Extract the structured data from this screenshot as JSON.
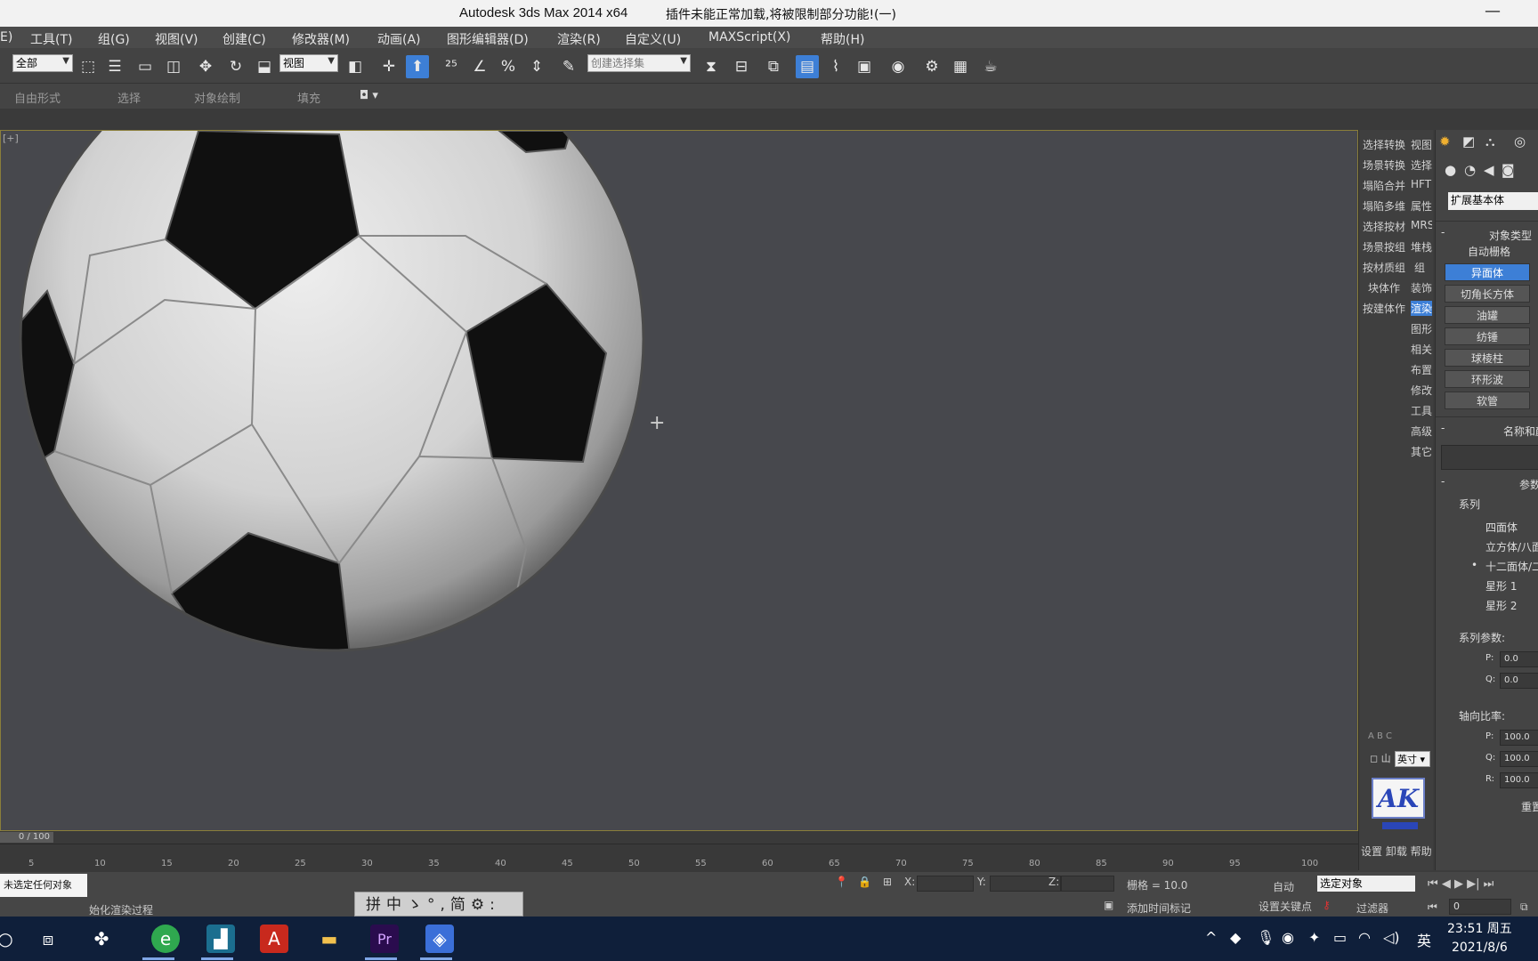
{
  "titlebar": {
    "title": "Autodesk 3ds Max  2014 x64",
    "warning": "插件未能正常加载,将被限制部分功能!(一)",
    "minimize": "—"
  },
  "menu": [
    "E)",
    "工具(T)",
    "组(G)",
    "视图(V)",
    "创建(C)",
    "修改器(M)",
    "动画(A)",
    "图形编辑器(D)",
    "渲染(R)",
    "自定义(U)",
    "MAXScript(X)",
    "帮助(H)"
  ],
  "toolbar": {
    "selection_filter": "全部",
    "ref_coord": "视图",
    "named_selection": "创建选择集"
  },
  "ribbon": [
    "自由形式",
    "选择",
    "对象绘制",
    "填充"
  ],
  "viewport": {
    "label": "[+]"
  },
  "cmdstrip": {
    "left": [
      "选择转换",
      "场景转换",
      "塌陷合并",
      "塌陷多维",
      "选择按材",
      "场景按组",
      "按材质组",
      "块体作",
      "按建体作"
    ],
    "right": [
      "视图",
      "选择",
      "HFT",
      "属性",
      "MRS",
      "堆栈",
      "组",
      "装饰",
      "渲染",
      "图形",
      "相关",
      "布置",
      "修改",
      "工具",
      "高级",
      "其它"
    ],
    "axis": "A  B  C",
    "units": "英寸",
    "logo": "AK",
    "bottom": "设置 卸载 帮助"
  },
  "props": {
    "object_type_dropdown": "扩展基本体",
    "object_type_header": "对象类型",
    "autogrid": "自动栅格",
    "buttons": [
      "异面体",
      "切角长方体",
      "油罐",
      "纺锤",
      "球棱柱",
      "环形波",
      "软管"
    ],
    "name_color": "名称和颜色",
    "params": "参数",
    "family": "系列",
    "radios": [
      "四面体",
      "立方体/八面体",
      "十二面体/二十面体",
      "星形 1",
      "星形 2"
    ],
    "family_params": "系列参数:",
    "pq": [
      {
        "label": "P:",
        "value": "0.0"
      },
      {
        "label": "Q:",
        "value": "0.0"
      }
    ],
    "axis_scale": "轴向比率:",
    "pqr": [
      {
        "label": "P:",
        "value": "100.0"
      },
      {
        "label": "Q:",
        "value": "100.0"
      },
      {
        "label": "R:",
        "value": "100.0"
      }
    ],
    "reset": "重置"
  },
  "timeline": {
    "slider": "0 / 100",
    "ticks": [
      "5",
      "10",
      "15",
      "20",
      "25",
      "30",
      "35",
      "40",
      "45",
      "50",
      "55",
      "60",
      "65",
      "70",
      "75",
      "80",
      "85",
      "90",
      "95",
      "100"
    ]
  },
  "status": {
    "prompt_title": "未选定任何对象",
    "message": "始化渲染过程",
    "coords": [
      {
        "label": "X:",
        "value": ""
      },
      {
        "label": "Y:",
        "value": ""
      },
      {
        "label": "Z:",
        "value": ""
      }
    ],
    "grid": "栅格 = 10.0",
    "add_time_tag": "添加时间标记",
    "auto": "自动",
    "selected_object": "选定对象",
    "set_key": "设置关键点",
    "filters": "过滤器",
    "frame": "0"
  },
  "ime": "拼中ゝ°,简⚙:",
  "taskbar": {
    "clock_time": "23:51 周五",
    "clock_date": "2021/8/6",
    "lang": "英"
  },
  "colors": {
    "accent": "#3d7fd6",
    "viewport_bg": "#47484d",
    "taskbar": "#0f1f3a"
  }
}
